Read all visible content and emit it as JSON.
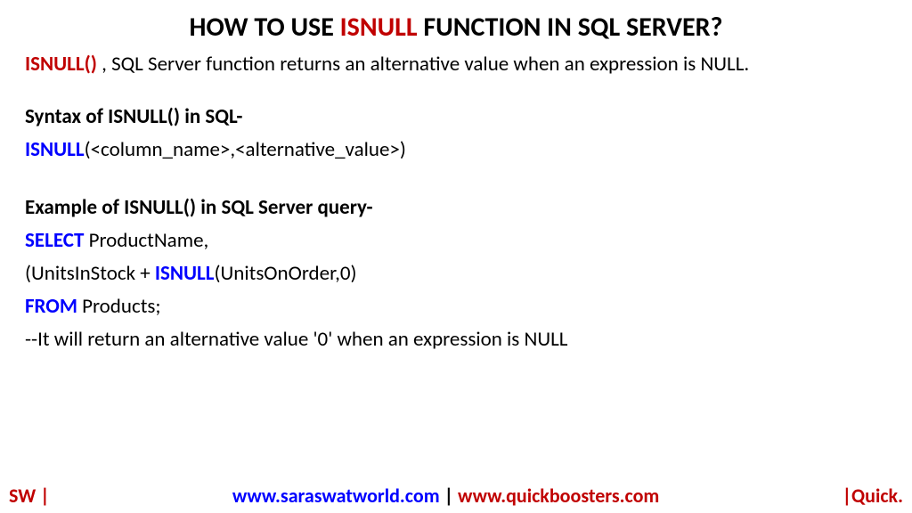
{
  "title": {
    "pre": "HOW TO USE ",
    "keyword": "ISNULL",
    "post": " FUNCTION IN SQL SERVER?"
  },
  "intro": {
    "keyword": "ISNULL()",
    "rest": " , SQL Server function returns an alternative value when an expression is NULL."
  },
  "syntax": {
    "heading": "Syntax of ISNULL() in SQL-",
    "fn": "ISNULL",
    "args": "(<column_name>,<alternative_value>)"
  },
  "example": {
    "heading": "Example of ISNULL() in SQL Server query-",
    "line1_kw": "SELECT",
    "line1_rest": " ProductName,",
    "line2_pre": "(UnitsInStock + ",
    "line2_kw": "ISNULL",
    "line2_post": "(UnitsOnOrder,0)",
    "line3_kw": "FROM",
    "line3_rest": " Products;",
    "comment": "--It will return an alternative value '0' when an expression is NULL"
  },
  "footer": {
    "left": "SW |",
    "url1": "www.saraswatworld.com",
    "sep": " | ",
    "url2": "www.quickboosters.com",
    "right": "|Quick."
  }
}
